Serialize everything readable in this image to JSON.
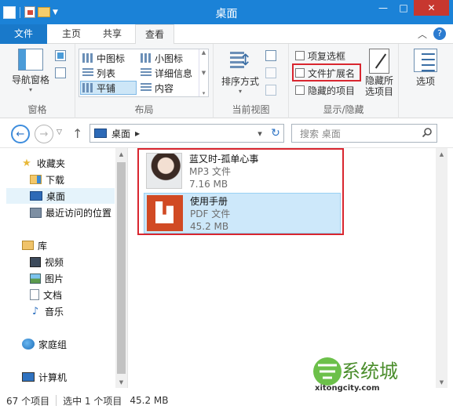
{
  "window": {
    "title": "桌面",
    "buttons": {
      "minimize": "—",
      "maximize": "□",
      "close": "✕"
    }
  },
  "tabs": {
    "file": "文件",
    "home": "主页",
    "share": "共享",
    "view": "查看"
  },
  "ribbon": {
    "pane": {
      "nav_pane": "导航窗格",
      "label": "窗格"
    },
    "layout": {
      "label": "布局",
      "items": {
        "medium_icons": "中图标",
        "small_icons": "小图标",
        "list": "列表",
        "details": "详细信息",
        "tiles": "平铺",
        "content": "内容"
      },
      "selected": "平铺"
    },
    "current_view": {
      "sort_by": "排序方式",
      "label": "当前视图"
    },
    "show_hide": {
      "item_checkboxes": "项复选框",
      "file_extensions": "文件扩展名",
      "hidden_items": "隐藏的项目",
      "hide_selected_line1": "隐藏所",
      "hide_selected_line2": "选项目",
      "label": "显示/隐藏"
    },
    "options": "选项"
  },
  "address": {
    "path": "桌面",
    "search_placeholder": "搜索 桌面"
  },
  "nav": {
    "favorites": "收藏夹",
    "downloads": "下载",
    "desktop": "桌面",
    "recent": "最近访问的位置",
    "libraries": "库",
    "videos": "视频",
    "pictures": "图片",
    "documents": "文档",
    "music": "音乐",
    "homegroup": "家庭组",
    "computer": "计算机"
  },
  "files": [
    {
      "name": "蓝又时-孤单心事",
      "type": "MP3 文件",
      "size": "7.16 MB"
    },
    {
      "name": "使用手册",
      "type": "PDF 文件",
      "size": "45.2 MB"
    }
  ],
  "status": {
    "count": "67 个项目",
    "selected": "选中 1 个项目",
    "selected_size": "45.2 MB"
  },
  "watermark": {
    "text": "系统城",
    "url": "xitongcity.com"
  },
  "colors": {
    "titlebar": "#1b82d7",
    "accent_red": "#d9262f",
    "selection": "#cde8fa"
  }
}
